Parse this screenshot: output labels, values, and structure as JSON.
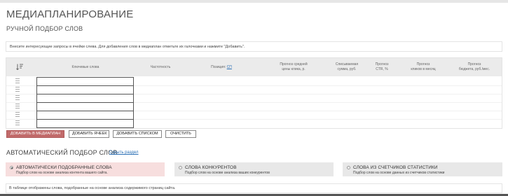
{
  "page": {
    "title": "МЕДИАПЛАНИРОВАНИЕ",
    "manual_section_title": "РУЧНОЙ ПОДБОР СЛОВ",
    "hint": "Внесите интересующие запросы в ячейки слева. Для добавления слов в медиаплан отметьте их галочками и нажмите \"Добавить\"."
  },
  "table": {
    "headers": {
      "keywords": "Ключевые слова",
      "frequency": "Частотность",
      "position_label": "Позиция:",
      "position_link": "СП",
      "cpc": [
        "Прогноз средней",
        "цены клика, р."
      ],
      "spend": [
        "Списываемая",
        "сумма, руб."
      ],
      "ctr": [
        "Прогноз",
        "CTR, %"
      ],
      "clicks": [
        "Прогноз",
        "кликов в месяц"
      ],
      "budget": [
        "Прогноз",
        "бюджета, руб./мес."
      ]
    },
    "rows": [
      {
        "keyword": ""
      },
      {
        "keyword": ""
      },
      {
        "keyword": ""
      },
      {
        "keyword": ""
      },
      {
        "keyword": ""
      },
      {
        "keyword": ""
      }
    ]
  },
  "buttons": {
    "add_to_mediaplan": "ДОБАВИТЬ В МЕДИАПЛАН",
    "add_cells": "ДОБАВИТЬ ЯЧЕЕК",
    "add_list": "ДОБАВИТЬ СПИСКОМ",
    "clear": "ОЧИСТИТЬ"
  },
  "auto": {
    "title": "АВТОМАТИЧЕСКИЙ ПОДБОР СЛОВ",
    "hide_link": "Скрыть раздел",
    "options": [
      {
        "title": "АВТОМАТИЧЕСКИ ПОДОБРАННЫЕ СЛОВА",
        "desc": "Подбор слов на основе анализа контента вашего сайта.",
        "selected": true
      },
      {
        "title": "СЛОВА КОНКУРЕНТОВ",
        "desc": "Подбор слов на основе анализа ваших конкурентов",
        "selected": false
      },
      {
        "title": "СЛОВА ИЗ СЧЕТЧИКОВ СТАТИСТИКИ",
        "desc": "Подбор слов на основе данных из счетчиков статистики",
        "selected": false
      }
    ],
    "footer_note": "В таблице отображены слова, подобранные на основе анализа содержимого страниц сайта."
  },
  "colors": {
    "accent_button": "#c16a6a",
    "selected_option_bg": "#f7dede",
    "option_bg": "#e8e8e8",
    "link": "#2a6fb5"
  }
}
